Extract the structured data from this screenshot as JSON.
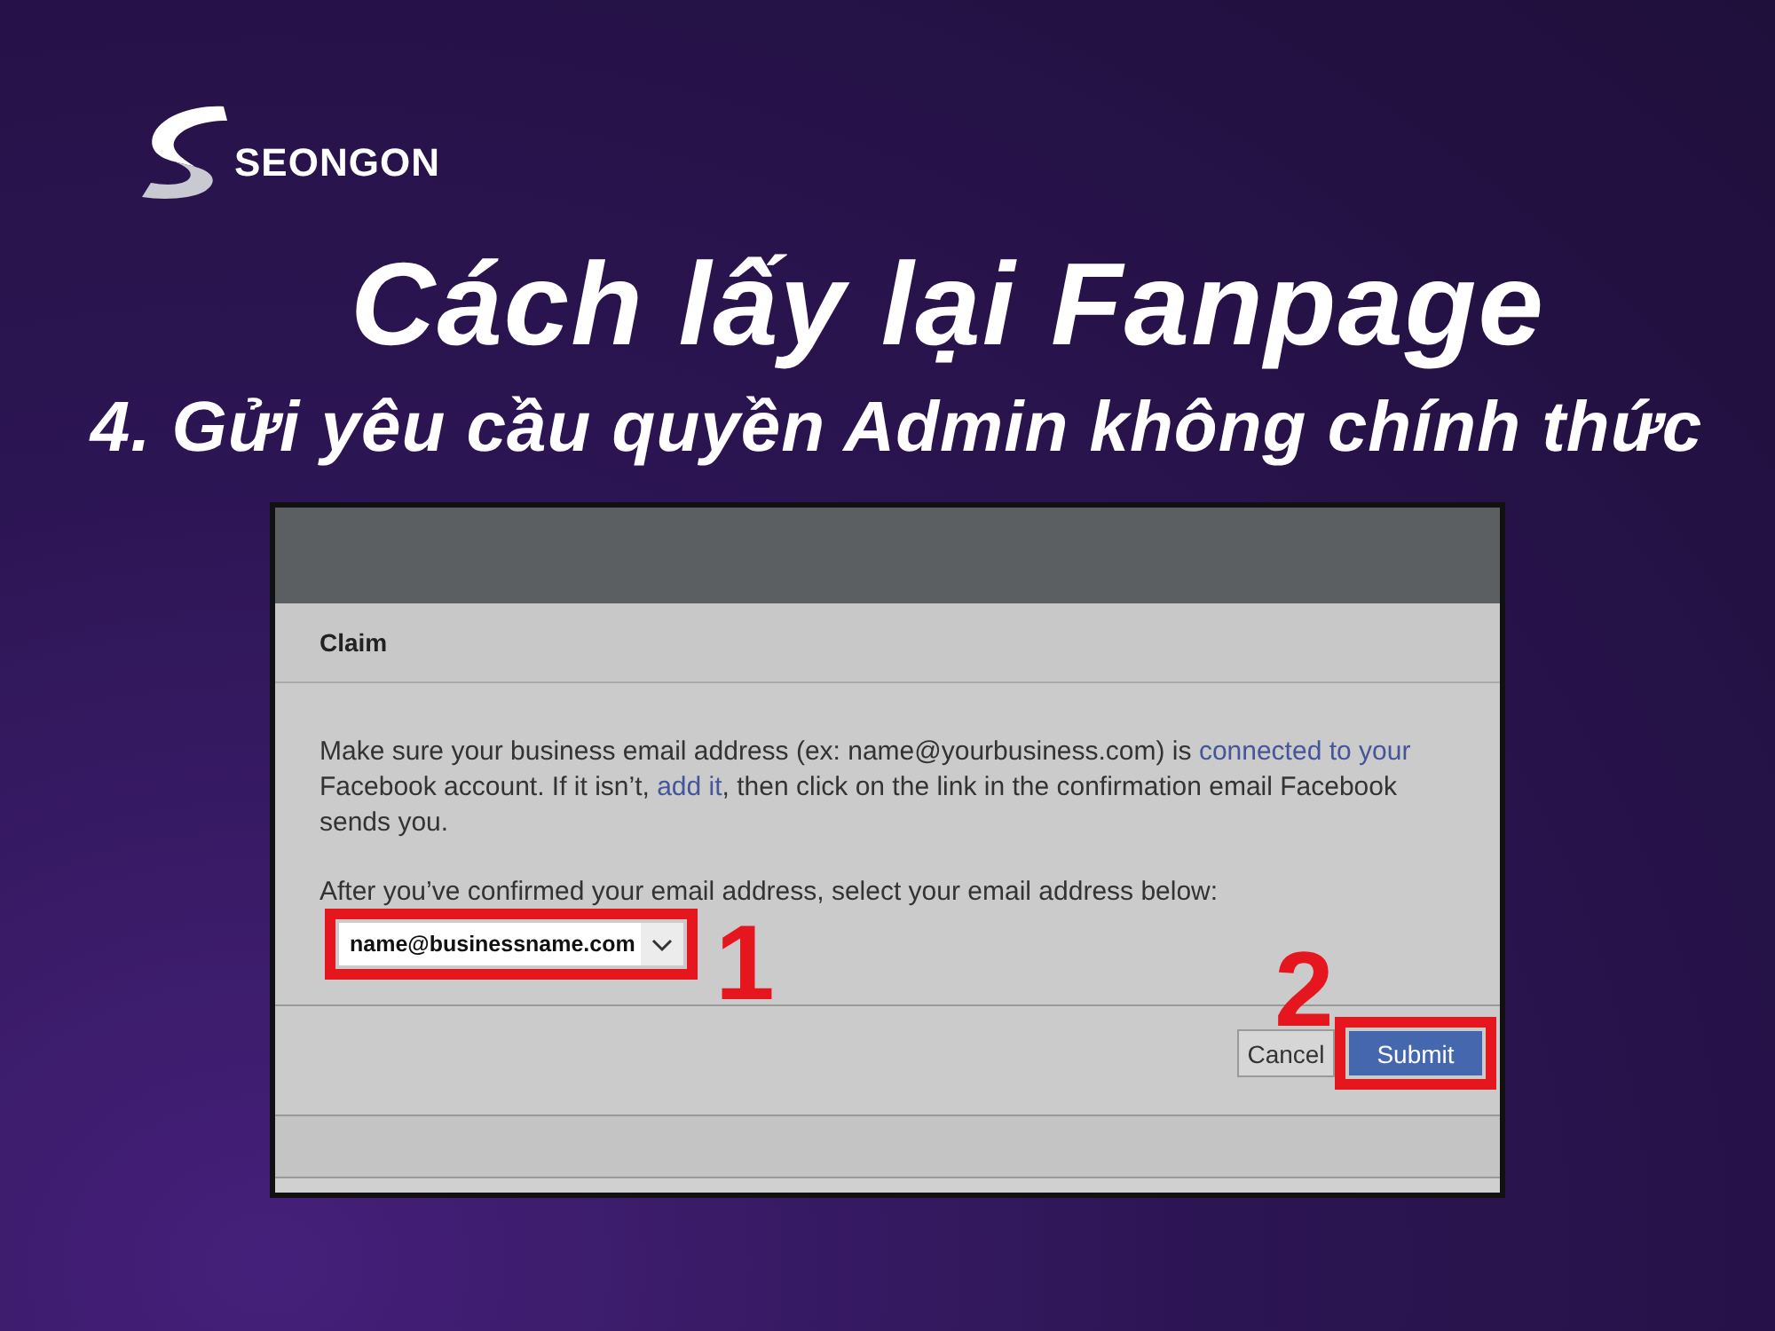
{
  "brand": {
    "name": "SEONGON"
  },
  "title": "Cách lấy lại Fanpage",
  "subtitle": "4. Gửi yêu cầu quyền Admin không chính thức",
  "screenshot": {
    "title": "Claim",
    "paragraph": [
      {
        "kind": "text",
        "text": "Make sure your business email address (ex: name@yourbusiness.com) is "
      },
      {
        "kind": "link",
        "text": "connected to your"
      },
      {
        "kind": "text",
        "text": " Facebook account. If it isn’t, "
      },
      {
        "kind": "link",
        "text": "add it"
      },
      {
        "kind": "text",
        "text": ", then click on the link in the confirmation email Facebook sends you."
      }
    ],
    "instruction": "After you’ve confirmed your email address, select your email address below:",
    "email_select": {
      "value": "name@businessname.com",
      "highlighted": true,
      "step": "1"
    },
    "buttons": [
      {
        "label": "Cancel",
        "kind": "secondary",
        "highlighted": false
      },
      {
        "label": "Submit",
        "kind": "primary",
        "highlighted": true,
        "step": "2"
      }
    ]
  }
}
